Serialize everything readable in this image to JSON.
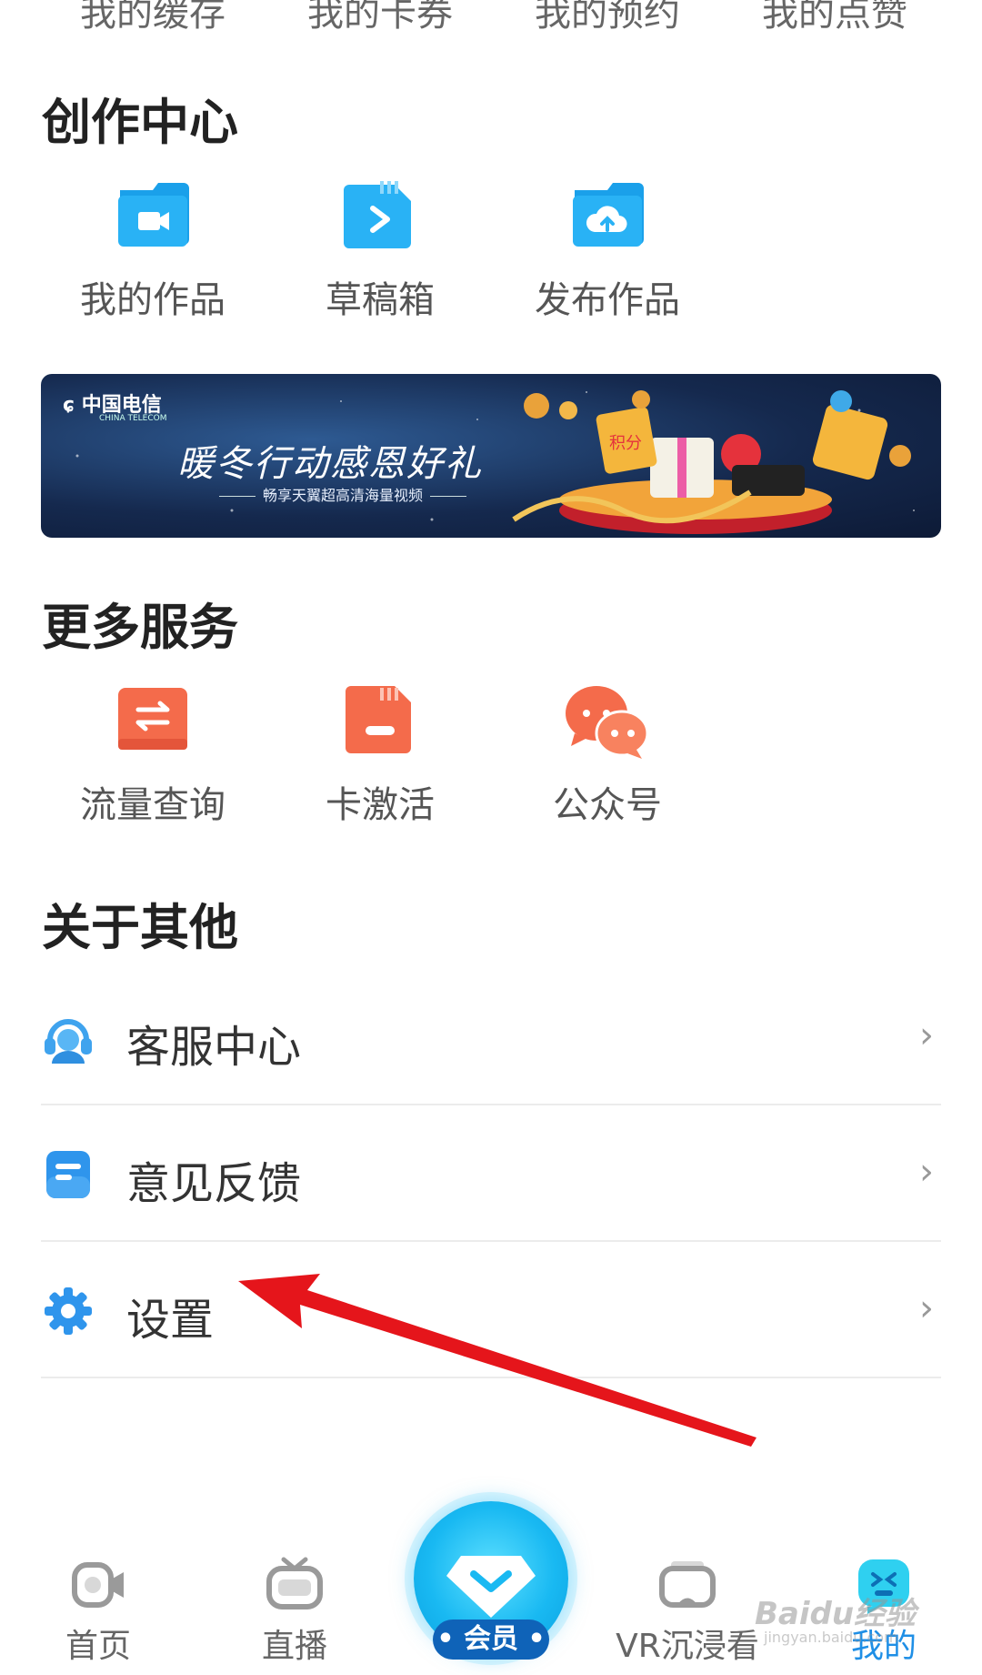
{
  "top_row": [
    "我的缓存",
    "我的卡券",
    "我的预约",
    "我的点赞"
  ],
  "creation": {
    "title": "创作中心",
    "items": [
      {
        "label": "我的作品",
        "icon": "video-folder-icon"
      },
      {
        "label": "草稿箱",
        "icon": "drafts-icon"
      },
      {
        "label": "发布作品",
        "icon": "upload-cloud-icon"
      }
    ]
  },
  "banner": {
    "logo": "中国电信",
    "logo_sub": "CHINA TELECOM",
    "headline": "暖冬行动感恩好礼",
    "subline": "畅享天翼超高清海量视频",
    "coin_label": "积分"
  },
  "more_services": {
    "title": "更多服务",
    "items": [
      {
        "label": "流量查询",
        "icon": "data-exchange-icon"
      },
      {
        "label": "卡激活",
        "icon": "sim-card-icon"
      },
      {
        "label": "公众号",
        "icon": "wechat-icon"
      }
    ]
  },
  "about": {
    "title": "关于其他",
    "items": [
      {
        "label": "客服中心",
        "icon": "customer-service-icon"
      },
      {
        "label": "意见反馈",
        "icon": "feedback-icon"
      },
      {
        "label": "设置",
        "icon": "settings-gear-icon"
      }
    ],
    "chevron": "›"
  },
  "tabbar": {
    "tabs": [
      {
        "label": "首页",
        "icon": "home-video-icon",
        "active": false
      },
      {
        "label": "直播",
        "icon": "tv-icon",
        "active": false
      },
      {
        "label": "VR沉浸看",
        "icon": "vr-headset-icon",
        "active": false
      },
      {
        "label": "我的",
        "icon": "profile-face-icon",
        "active": true
      }
    ],
    "vip_label": "• 会员 •"
  },
  "watermark": {
    "text": "Baidu经验",
    "sub": "jingyan.baidu.com"
  },
  "colors": {
    "accent": "#1f8fe6",
    "arrow": "#e5151b",
    "service_orange": "#f46b4b"
  }
}
